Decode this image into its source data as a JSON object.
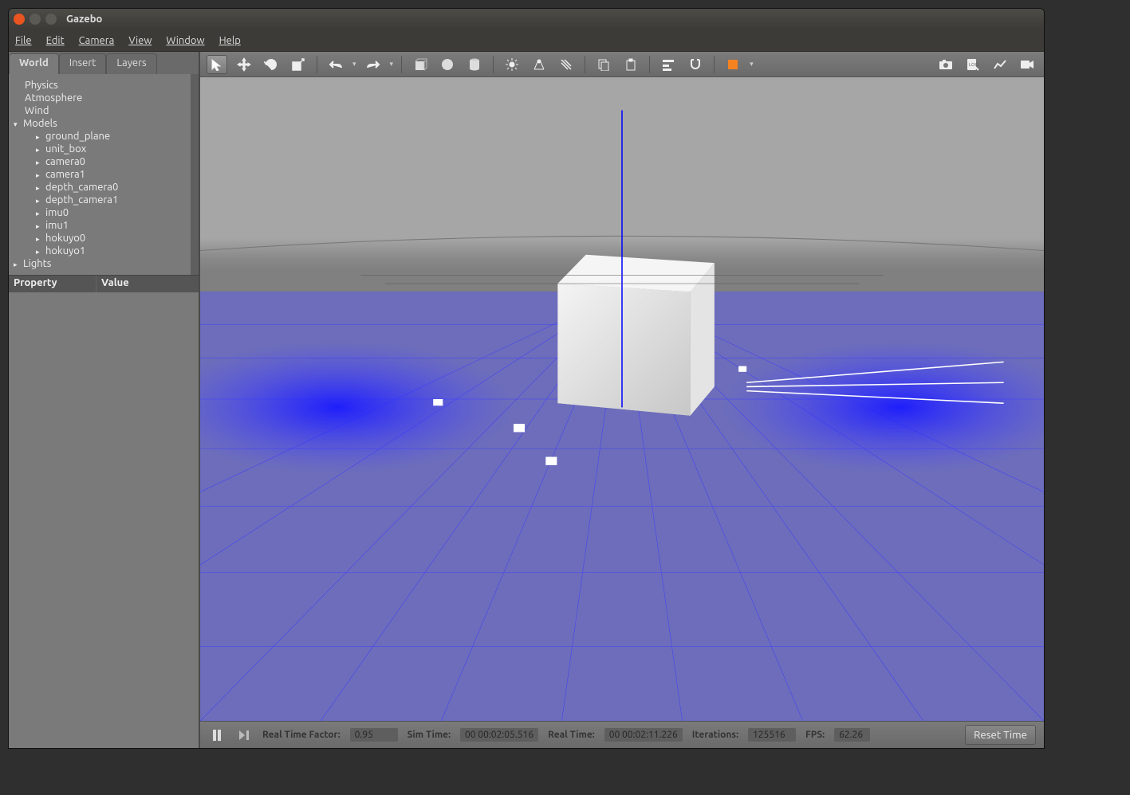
{
  "window": {
    "title": "Gazebo"
  },
  "menubar": [
    "File",
    "Edit",
    "Camera",
    "View",
    "Window",
    "Help"
  ],
  "sidebar": {
    "tabs": [
      "World",
      "Insert",
      "Layers"
    ],
    "active_tab": 0,
    "tree": {
      "physics": "Physics",
      "atmosphere": "Atmosphere",
      "wind": "Wind",
      "models_label": "Models",
      "models": [
        "ground_plane",
        "unit_box",
        "camera0",
        "camera1",
        "depth_camera0",
        "depth_camera1",
        "imu0",
        "imu1",
        "hokuyo0",
        "hokuyo1"
      ],
      "lights_label": "Lights"
    },
    "props": {
      "col1": "Property",
      "col2": "Value"
    }
  },
  "toolbar": {
    "icons": {
      "select": "select-arrow-icon",
      "move": "move-icon",
      "rotate": "rotate-icon",
      "scale": "scale-icon",
      "undo": "undo-icon",
      "redo": "redo-icon",
      "box": "box-icon",
      "sphere": "sphere-icon",
      "cylinder": "cylinder-icon",
      "point_light": "point-light-icon",
      "spot_light": "spot-light-icon",
      "dir_light": "directional-light-icon",
      "copy": "copy-icon",
      "paste": "paste-icon",
      "align": "align-icon",
      "snap": "snap-icon",
      "selection_box": "selection-box-icon",
      "screenshot": "camera-icon",
      "log": "log-icon",
      "plot": "plot-icon",
      "record": "record-icon"
    }
  },
  "statusbar": {
    "rtf_label": "Real Time Factor:",
    "rtf_value": "0.95",
    "sim_label": "Sim Time:",
    "sim_value": "00 00:02:05.516",
    "real_label": "Real Time:",
    "real_value": "00 00:02:11.226",
    "iter_label": "Iterations:",
    "iter_value": "125516",
    "fps_label": "FPS:",
    "fps_value": "62.26",
    "reset_label": "Reset Time"
  }
}
